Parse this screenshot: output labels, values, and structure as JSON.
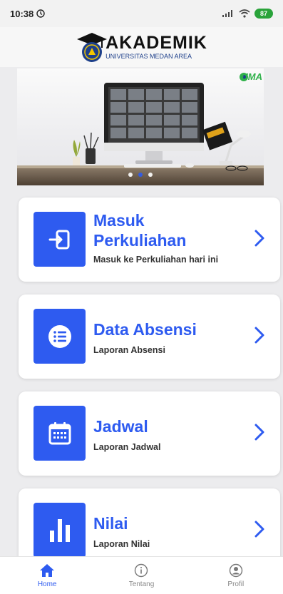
{
  "status": {
    "time": "10:38",
    "battery": "87"
  },
  "header": {
    "logo_title": "AKADEMIK",
    "logo_subtitle": "UNIVERSITAS MEDAN AREA"
  },
  "banner": {
    "badge": "UMA",
    "slide_count": 3,
    "active_slide": 2
  },
  "menu": [
    {
      "title_line1": "Masuk",
      "title_line2": "Perkuliahan",
      "subtitle": "Masuk ke Perkuliahan hari ini",
      "icon": "login-icon"
    },
    {
      "title_line1": "Data Absensi",
      "subtitle": "Laporan Absensi",
      "icon": "list-icon"
    },
    {
      "title_line1": "Jadwal",
      "subtitle": "Laporan Jadwal",
      "icon": "calendar-icon"
    },
    {
      "title_line1": "Nilai",
      "subtitle": "Laporan Nilai",
      "icon": "bar-chart-icon"
    }
  ],
  "nav": [
    {
      "label": "Home",
      "icon": "home-icon",
      "active": true
    },
    {
      "label": "Tentang",
      "icon": "info-icon",
      "active": false
    },
    {
      "label": "Profil",
      "icon": "profile-icon",
      "active": false
    }
  ],
  "colors": {
    "accent": "#2e5bf0",
    "background": "#ececee",
    "battery": "#29a33a"
  }
}
